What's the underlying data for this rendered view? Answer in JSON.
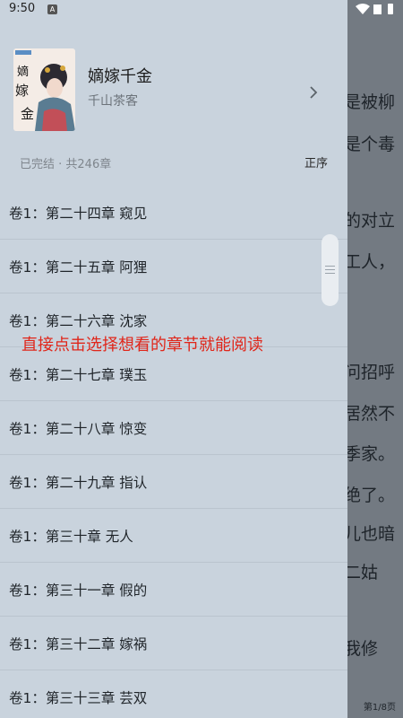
{
  "status_bar": {
    "time": "9:50",
    "notification_badge": "A"
  },
  "book": {
    "title": "嫡嫁千金",
    "author": "千山茶客",
    "status": "已完结 · 共246章",
    "sort_label": "正序",
    "cover_text": "嫡嫁千金"
  },
  "chapters": [
    "卷1：第二十四章 窥见",
    "卷1：第二十五章 阿狸",
    "卷1：第二十六章 沈家",
    "卷1：第二十七章 璞玉",
    "卷1：第二十八章 惊变",
    "卷1：第二十九章 指认",
    "卷1：第三十章 无人",
    "卷1：第三十一章 假的",
    "卷1：第三十二章 嫁祸",
    "卷1：第三十三章 芸双"
  ],
  "overlay_tip": "直接点击选择想看的章节就能阅读",
  "reader": {
    "lines": [
      "是被柳",
      "是个毒",
      "的对立",
      "工人，",
      "问招呼",
      "居然不",
      "季家。",
      "绝了。",
      "儿也暗",
      "二姑",
      "我修"
    ],
    "page_indicator": "第1/8页"
  },
  "colors": {
    "drawer_bg": "#c9d3dd",
    "overlay_tip": "#e0261a"
  }
}
